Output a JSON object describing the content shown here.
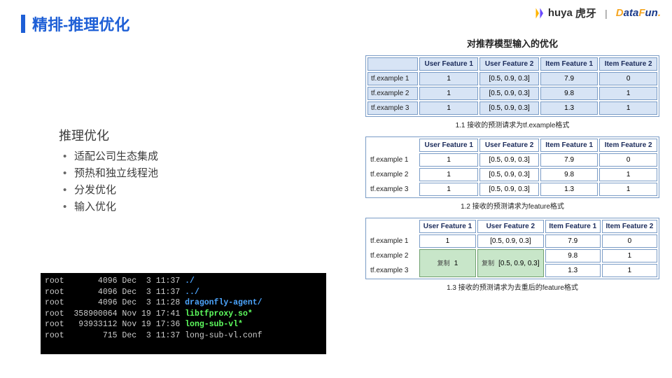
{
  "logos": {
    "huya_en": "huya",
    "huya_cn": "虎牙",
    "separator": "|",
    "datafun": {
      "d": "D",
      "ata": "ata",
      "f": "F",
      "un": "un",
      "dot": "."
    }
  },
  "title": "精排-推理优化",
  "section": {
    "heading": "推理优化",
    "items": [
      "适配公司生态集成",
      "预热和独立线程池",
      "分发优化",
      "输入优化"
    ]
  },
  "terminal": {
    "lines": [
      {
        "user": "root",
        "size": "4096",
        "date": "Dec  3 11:37",
        "name": "./",
        "cls": "t-blue"
      },
      {
        "user": "root",
        "size": "4096",
        "date": "Dec  3 11:37",
        "name": "../",
        "cls": "t-blue"
      },
      {
        "user": "root",
        "size": "4096",
        "date": "Dec  3 11:28",
        "name": "dragonfly-agent/",
        "cls": "t-blue"
      },
      {
        "user": "root",
        "size": "358900064",
        "date": "Nov 19 17:41",
        "name": "libtfproxy.so*",
        "cls": "t-green"
      },
      {
        "user": "root",
        "size": "93933112",
        "date": "Nov 19 17:36",
        "name": "long-sub-vl*",
        "cls": "t-green"
      },
      {
        "user": "root",
        "size": "715",
        "date": "Dec  3 11:37",
        "name": "long-sub-vl.conf",
        "cls": ""
      }
    ]
  },
  "right": {
    "title": "对推荐模型输入的优化",
    "headers": [
      "User Feature 1",
      "User Feature 2",
      "Item Feature 1",
      "Item Feature 2"
    ],
    "uf2": "[0.5, 0.9, 0.3]",
    "merge_tag": "复制",
    "table1": {
      "rows": [
        {
          "label": "tf.example 1",
          "c1": "1",
          "c3": "7.9",
          "c4": "0"
        },
        {
          "label": "tf.example 2",
          "c1": "1",
          "c3": "9.8",
          "c4": "1"
        },
        {
          "label": "tf.example 3",
          "c1": "1",
          "c3": "1.3",
          "c4": "1"
        }
      ],
      "caption": "1.1 接收的预测请求为tf.example格式"
    },
    "table2": {
      "rows": [
        {
          "label": "tf.example 1",
          "c1": "1",
          "c3": "7.9",
          "c4": "0"
        },
        {
          "label": "tf.example 2",
          "c1": "1",
          "c3": "9.8",
          "c4": "1"
        },
        {
          "label": "tf.example 3",
          "c1": "1",
          "c3": "1.3",
          "c4": "1"
        }
      ],
      "caption": "1.2 接收的预测请求为feature格式"
    },
    "table3": {
      "rows": [
        {
          "label": "tf.example 1",
          "c1": "1",
          "c3": "7.9",
          "c4": "0"
        },
        {
          "label": "tf.example 2",
          "c3": "9.8",
          "c4": "1"
        },
        {
          "label": "tf.example 3",
          "c3": "1.3",
          "c4": "1"
        }
      ],
      "merged_c1": "1",
      "caption": "1.3 接收的预测请求为去重后的feature格式"
    }
  }
}
